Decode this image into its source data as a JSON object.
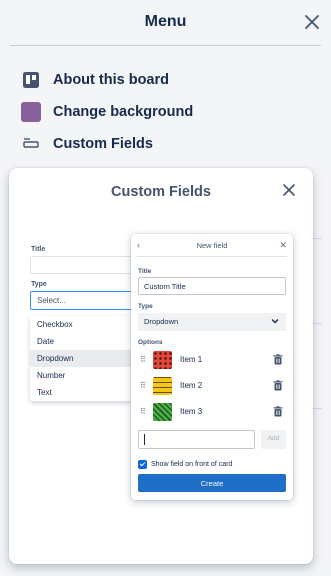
{
  "menu": {
    "title": "Menu",
    "close_icon": "close-icon",
    "items": [
      {
        "label": "About this board",
        "icon": "board-icon"
      },
      {
        "label": "Change background",
        "icon": "background-swatch",
        "color": "#89609e"
      },
      {
        "label": "Custom Fields",
        "icon": "custom-fields-icon"
      }
    ]
  },
  "popover": {
    "title": "Custom Fields",
    "close_icon": "close-icon",
    "left_form": {
      "title_label": "Title",
      "type_label": "Type",
      "type_placeholder": "Select...",
      "type_options": [
        "Checkbox",
        "Date",
        "Dropdown",
        "Number",
        "Text"
      ],
      "highlighted_option": "Dropdown"
    },
    "new_field": {
      "header": "New field",
      "back_icon": "chevron-left-icon",
      "close_icon": "close-icon",
      "title_label": "Title",
      "title_value": "Custom Title",
      "type_label": "Type",
      "type_value": "Dropdown",
      "options_label": "Options",
      "options": [
        {
          "name": "Item 1",
          "color": "#e2483d"
        },
        {
          "name": "Item 2",
          "color": "#f5c518"
        },
        {
          "name": "Item 3",
          "color": "#4bb04a"
        }
      ],
      "add_label": "Add",
      "show_on_card_label": "Show field on front of card",
      "show_on_card_checked": true,
      "create_label": "Create"
    }
  },
  "colors": {
    "accent": "#1f6ec8",
    "checkbox": "#0c66e4",
    "text": "#172b4d"
  }
}
